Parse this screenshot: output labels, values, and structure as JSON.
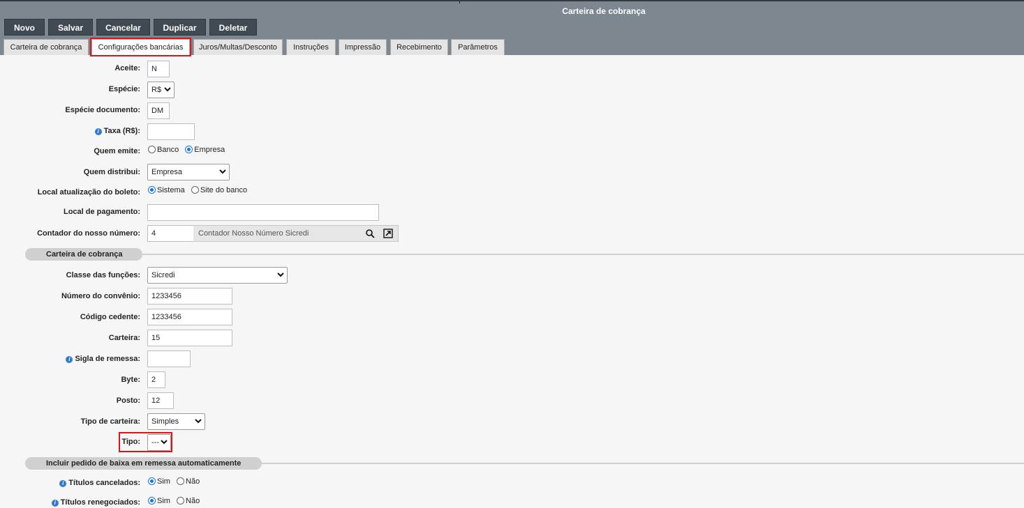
{
  "window": {
    "title": "Carteira de cobrança"
  },
  "toolbar": {
    "novo": "Novo",
    "salvar": "Salvar",
    "cancelar": "Cancelar",
    "duplicar": "Duplicar",
    "deletar": "Deletar"
  },
  "tabs": [
    {
      "label": "Carteira de cobrança"
    },
    {
      "label": "Configurações bancárias",
      "active": true
    },
    {
      "label": "Juros/Multas/Desconto"
    },
    {
      "label": "Instruções"
    },
    {
      "label": "Impressão"
    },
    {
      "label": "Recebimento"
    },
    {
      "label": "Parâmetros"
    }
  ],
  "form": {
    "aceite": {
      "label": "Aceite:",
      "value": "N"
    },
    "especie": {
      "label": "Espécie:",
      "value": "R$"
    },
    "especie_documento": {
      "label": "Espécie documento:",
      "value": "DM"
    },
    "taxa": {
      "label": "Taxa (R$):",
      "value": ""
    },
    "quem_emite": {
      "label": "Quem emite:",
      "options": [
        "Banco",
        "Empresa"
      ],
      "selected": "Empresa"
    },
    "quem_distribui": {
      "label": "Quem distribui:",
      "value": "Empresa"
    },
    "local_atualizacao": {
      "label": "Local atualização do boleto:",
      "options": [
        "Sistema",
        "Site do banco"
      ],
      "selected": "Sistema"
    },
    "local_pagamento": {
      "label": "Local de pagamento:",
      "value": ""
    },
    "contador": {
      "label": "Contador do nosso número:",
      "value": "4",
      "description": "Contador Nosso Número Sicredi"
    }
  },
  "section_carteira": {
    "title": "Carteira de cobrança",
    "classe_funcoes": {
      "label": "Classe das funções:",
      "value": "Sicredi"
    },
    "numero_convenio": {
      "label": "Número do convênio:",
      "value": "1233456"
    },
    "codigo_cedente": {
      "label": "Código cedente:",
      "value": "1233456"
    },
    "carteira": {
      "label": "Carteira:",
      "value": "15"
    },
    "sigla_remessa": {
      "label": "Sigla de remessa:",
      "value": ""
    },
    "byte": {
      "label": "Byte:",
      "value": "2"
    },
    "posto": {
      "label": "Posto:",
      "value": "12"
    },
    "tipo_carteira": {
      "label": "Tipo de carteira:",
      "value": "Simples"
    },
    "tipo": {
      "label": "Tipo:",
      "value": "---"
    }
  },
  "section_baixa": {
    "title": "Incluir pedido de baixa em remessa automaticamente",
    "titulos_cancelados": {
      "label": "Títulos cancelados:",
      "options": [
        "Sim",
        "Não"
      ],
      "selected": "Sim"
    },
    "titulos_renegociados": {
      "label": "Títulos renegociados:",
      "options": [
        "Sim",
        "Não"
      ],
      "selected": "Sim"
    }
  },
  "colors": {
    "highlight": "#d9161d",
    "topbar": "#7d8790",
    "button": "#404a53",
    "radio_accent": "#1a73e8"
  },
  "icons": [
    "info-icon",
    "search-icon",
    "open-external-icon",
    "chevron-down-icon"
  ]
}
